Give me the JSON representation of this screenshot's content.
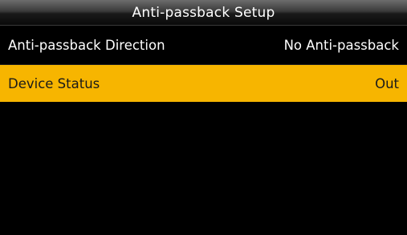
{
  "header": {
    "title": "Anti-passback Setup"
  },
  "menu": {
    "items": [
      {
        "label": "Anti-passback Direction",
        "value": "No Anti-passback",
        "selected": false
      },
      {
        "label": "Device Status",
        "value": "Out",
        "selected": true
      }
    ]
  },
  "colors": {
    "background": "#000000",
    "selected_row": "#f7b500",
    "text": "#ffffff",
    "selected_text": "#1a1a1a"
  }
}
